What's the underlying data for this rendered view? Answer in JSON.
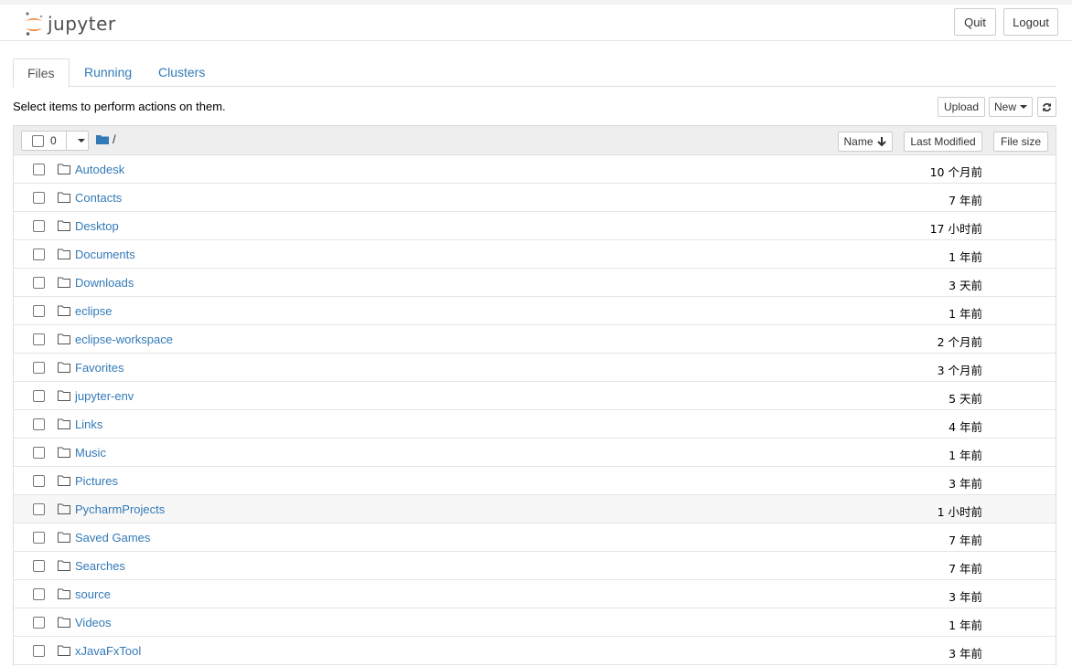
{
  "app": {
    "name": "jupyter",
    "quit_label": "Quit",
    "logout_label": "Logout"
  },
  "tabs": [
    {
      "label": "Files",
      "active": true
    },
    {
      "label": "Running",
      "active": false
    },
    {
      "label": "Clusters",
      "active": false
    }
  ],
  "toolbar": {
    "instructions": "Select items to perform actions on them.",
    "upload_label": "Upload",
    "new_label": "New"
  },
  "list_header": {
    "selected_count": "0",
    "breadcrumb": "/",
    "sort_name_label": "Name",
    "sort_modified_label": "Last Modified",
    "sort_size_label": "File size"
  },
  "items": [
    {
      "name": "Autodesk",
      "modified": "10 个月前"
    },
    {
      "name": "Contacts",
      "modified": "7 年前"
    },
    {
      "name": "Desktop",
      "modified": "17 小时前"
    },
    {
      "name": "Documents",
      "modified": "1 年前"
    },
    {
      "name": "Downloads",
      "modified": "3 天前"
    },
    {
      "name": "eclipse",
      "modified": "1 年前"
    },
    {
      "name": "eclipse-workspace",
      "modified": "2 个月前"
    },
    {
      "name": "Favorites",
      "modified": "3 个月前"
    },
    {
      "name": "jupyter-env",
      "modified": "5 天前"
    },
    {
      "name": "Links",
      "modified": "4 年前"
    },
    {
      "name": "Music",
      "modified": "1 年前"
    },
    {
      "name": "Pictures",
      "modified": "3 年前"
    },
    {
      "name": "PycharmProjects",
      "modified": "1 小时前"
    },
    {
      "name": "Saved Games",
      "modified": "7 年前"
    },
    {
      "name": "Searches",
      "modified": "7 年前"
    },
    {
      "name": "source",
      "modified": "3 年前"
    },
    {
      "name": "Videos",
      "modified": "1 年前"
    },
    {
      "name": "xJavaFxTool",
      "modified": "3 年前"
    }
  ],
  "colors": {
    "link": "#337ab7",
    "logo_orange": "#f37726",
    "header_bg": "#eeeeee"
  }
}
